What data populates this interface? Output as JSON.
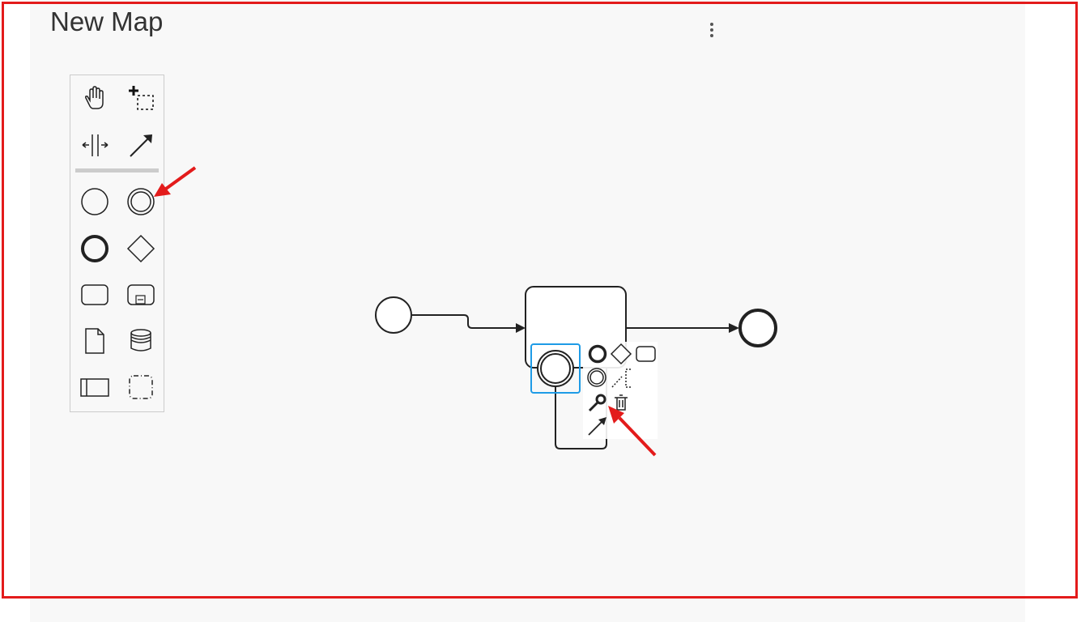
{
  "map": {
    "title": "New Map"
  },
  "header": {
    "menu_icon": "more-vertical-icon"
  },
  "palette": {
    "tools": [
      {
        "name": "hand-tool",
        "icon": "hand-icon"
      },
      {
        "name": "lasso-tool",
        "icon": "lasso-icon"
      },
      {
        "name": "space-tool",
        "icon": "space-tool-icon"
      },
      {
        "name": "global-connect-tool",
        "icon": "connect-arrow-icon"
      },
      {
        "name": "create-start-event",
        "icon": "start-event-icon"
      },
      {
        "name": "create-intermediate-event",
        "icon": "intermediate-event-icon"
      },
      {
        "name": "create-end-event",
        "icon": "end-event-icon"
      },
      {
        "name": "create-gateway",
        "icon": "gateway-diamond-icon"
      },
      {
        "name": "create-task",
        "icon": "task-icon"
      },
      {
        "name": "create-subprocess",
        "icon": "subprocess-icon"
      },
      {
        "name": "create-data-object",
        "icon": "data-object-icon"
      },
      {
        "name": "create-data-store",
        "icon": "data-store-icon"
      },
      {
        "name": "create-pool",
        "icon": "pool-icon"
      },
      {
        "name": "create-group",
        "icon": "group-icon"
      }
    ]
  },
  "diagram": {
    "elements": [
      "start-event",
      "task",
      "boundary-intermediate-event",
      "end-event"
    ],
    "context_pad": [
      "append-end-event",
      "append-gateway",
      "append-task",
      "append-intermediate-event",
      "append-text-annotation",
      "change-type-wrench",
      "delete-trash",
      "connect-arrow"
    ]
  },
  "annotations": {
    "arrow_color": "#e31b1b",
    "selection_color": "#1e9be6"
  }
}
